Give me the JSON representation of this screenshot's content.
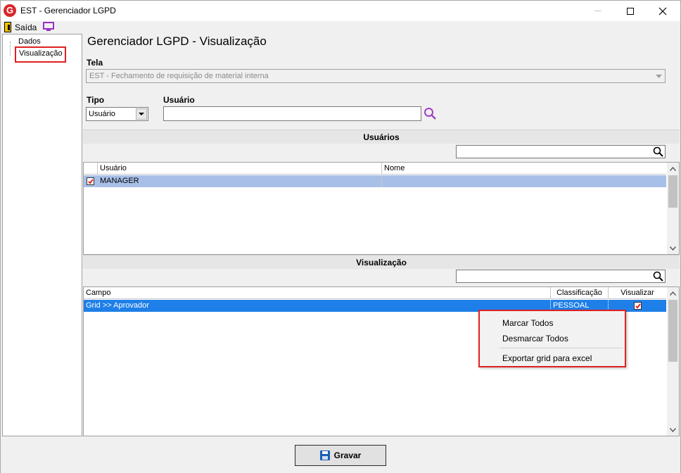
{
  "window": {
    "title": "EST - Gerenciador LGPD",
    "app_icon_letter": "G"
  },
  "menubar": {
    "exit_label": "Saída"
  },
  "tree": {
    "items": [
      "Dados",
      "Visualização"
    ],
    "selected": "Visualização"
  },
  "main": {
    "title": "Gerenciador LGPD - Visualização",
    "tela_label": "Tela",
    "tela_value": "EST - Fechamento de requisição de material interna",
    "tipo_label": "Tipo",
    "tipo_value": "Usuário",
    "usuario_label": "Usuário",
    "usuario_value": ""
  },
  "usuarios_section": {
    "header": "Usuários",
    "search_value": "",
    "columns": [
      "Usuário",
      "Nome"
    ],
    "rows": [
      {
        "checked": true,
        "usuario": "MANAGER",
        "nome": ""
      }
    ]
  },
  "visualizacao_section": {
    "header": "Visualização",
    "search_value": "",
    "columns": [
      "Campo",
      "Classificação",
      "Visualizar"
    ],
    "rows": [
      {
        "campo": "Grid >> Aprovador",
        "classificacao": "PESSOAL",
        "visualizar": true
      }
    ]
  },
  "context_menu": {
    "items": [
      "Marcar Todos",
      "Desmarcar Todos",
      "Exportar grid para excel"
    ]
  },
  "footer": {
    "gravar_label": "Gravar"
  },
  "colors": {
    "selection_blue": "#1e7fe8",
    "usuarios_selection": "#a8c0e8",
    "highlight_red": "#e02020",
    "search_icon_purple": "#a040c8"
  }
}
